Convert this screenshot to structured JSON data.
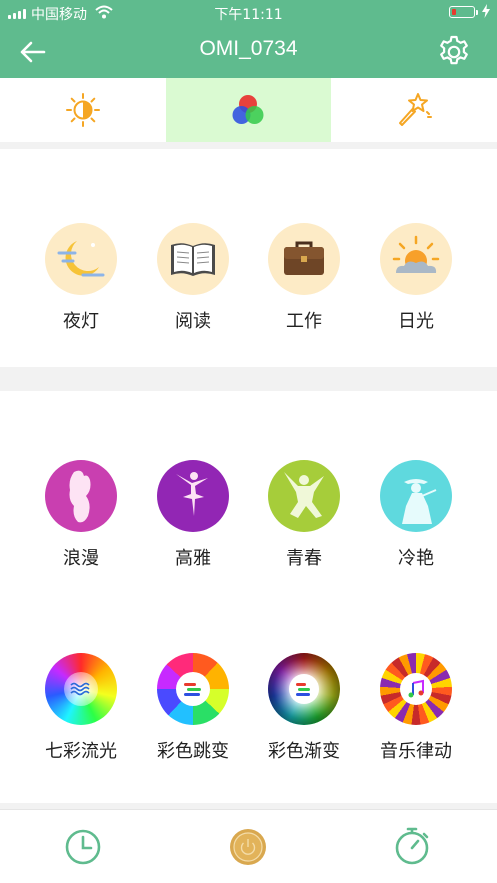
{
  "status_bar": {
    "carrier": "中国移动",
    "time": "下午11:11"
  },
  "header": {
    "title": "OMI_0734"
  },
  "tabs": [
    {
      "name": "brightness",
      "icon": "brightness-icon"
    },
    {
      "name": "color",
      "icon": "rgb-color-icon",
      "active": true
    },
    {
      "name": "magic",
      "icon": "magic-wand-icon"
    }
  ],
  "scenes": [
    {
      "label": "夜灯",
      "icon": "moon-night-icon"
    },
    {
      "label": "阅读",
      "icon": "open-book-icon"
    },
    {
      "label": "工作",
      "icon": "briefcase-icon"
    },
    {
      "label": "日光",
      "icon": "sun-cloud-icon"
    }
  ],
  "moods": [
    {
      "label": "浪漫",
      "icon": "couple-silhouette-icon",
      "color": "#c93fb0"
    },
    {
      "label": "高雅",
      "icon": "ballerina-silhouette-icon",
      "color": "#9226b4"
    },
    {
      "label": "青春",
      "icon": "dancer-silhouette-icon",
      "color": "#a6cd3a"
    },
    {
      "label": "冷艳",
      "icon": "lady-hat-silhouette-icon",
      "color": "#5fd9de"
    }
  ],
  "effects": [
    {
      "label": "七彩流光",
      "icon": "color-flow-icon"
    },
    {
      "label": "彩色跳变",
      "icon": "color-jump-icon"
    },
    {
      "label": "彩色渐变",
      "icon": "color-gradient-icon"
    },
    {
      "label": "音乐律动",
      "icon": "music-rhythm-icon"
    }
  ],
  "bottom_bar": {
    "timer_icon": "clock-icon",
    "power_icon": "power-icon",
    "countdown_icon": "stopwatch-icon"
  },
  "colors": {
    "header": "#5fbb8e",
    "scene_circle": "#fdebc6",
    "active_tab": "#dafad2",
    "accent_orange": "#f5a623",
    "bottom_icon": "#5fbb8e",
    "power": "#d9a84f"
  }
}
